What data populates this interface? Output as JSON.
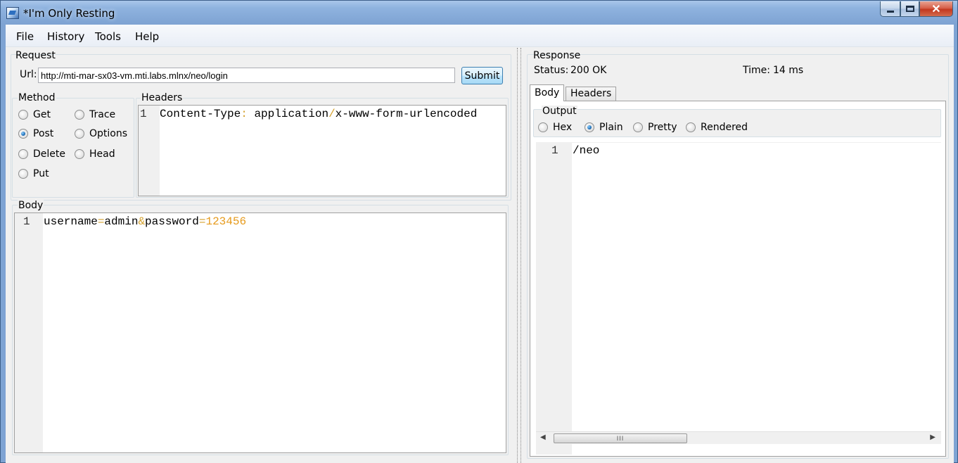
{
  "window": {
    "title": "*I'm Only Resting"
  },
  "menu": {
    "items": [
      "File",
      "History",
      "Tools",
      "Help"
    ]
  },
  "request": {
    "group_title": "Request",
    "url_label": "Url:",
    "url_value": "http://mti-mar-sx03-vm.mti.labs.mlnx/neo/login",
    "submit_label": "Submit",
    "method": {
      "title": "Method",
      "options": [
        "Get",
        "Trace",
        "Post",
        "Options",
        "Delete",
        "Head",
        "Put"
      ],
      "selected": "Post"
    },
    "headers": {
      "title": "Headers",
      "line_number": "1",
      "key": "Content-Type",
      "sep": ":",
      "value_a": "application",
      "slash": "/",
      "value_b": "x-www-form-urlencoded"
    },
    "body": {
      "title": "Body",
      "line_number": "1",
      "k1": "username",
      "eq1": "=",
      "v1": "admin",
      "amp": "&",
      "k2": "password",
      "eq2": "=",
      "v2": "123456"
    }
  },
  "response": {
    "group_title": "Response",
    "status_label": "Status:",
    "status_value": "200 OK",
    "time_label": "Time:",
    "time_value": "14 ms",
    "tabs": [
      "Body",
      "Headers"
    ],
    "active_tab": "Body",
    "output": {
      "title": "Output",
      "options": [
        "Hex",
        "Plain",
        "Pretty",
        "Rendered"
      ],
      "selected": "Plain"
    },
    "body": {
      "line_number": "1",
      "text": "/neo"
    },
    "scrollbar_grip": "III"
  },
  "colors": {
    "token_operator": "#d4a02c",
    "token_number": "#e69a1b",
    "radio_selected": "#1f6fb8",
    "button_border": "#3c7fb1"
  }
}
